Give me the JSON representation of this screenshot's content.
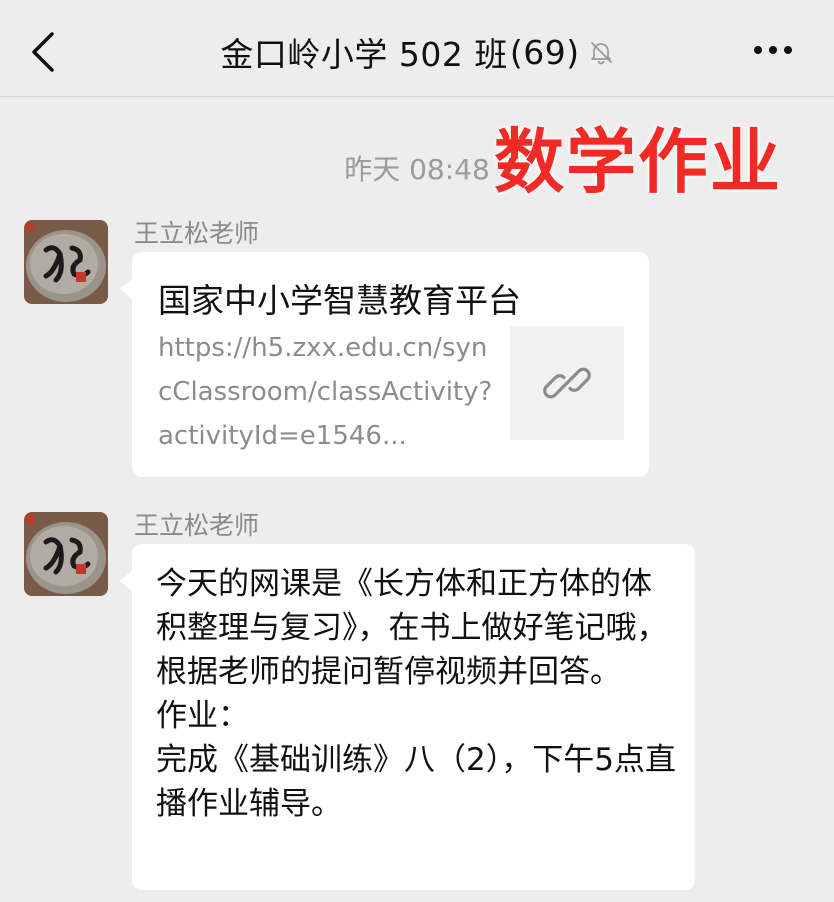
{
  "header": {
    "title": "金口岭小学 502 班",
    "member_count": "(69)",
    "back_icon": "chevron-left-icon",
    "mute_icon": "bell-slash-icon",
    "more_icon": "ellipsis-icon"
  },
  "overlay": {
    "label": "数学作业",
    "color": "#f22a25"
  },
  "timestamp": "昨天 08:48",
  "messages": [
    {
      "sender": "王立松老师",
      "type": "link",
      "title": "国家中小学智慧教育平台",
      "url": "https://h5.zxx.edu.cn/syncClassroom/classActivity?activityId=e1546...",
      "thumb_icon": "link-icon"
    },
    {
      "sender": "王立松老师",
      "type": "text",
      "text": "今天的网课是《长方体和正方体的体积整理与复习》，在书上做好笔记哦，根据老师的提问暂停视频并回答。\n作业：\n完成《基础训练》八（2），下午5点直播作业辅导。"
    }
  ],
  "colors": {
    "background": "#ededed",
    "bubble": "#ffffff",
    "secondary_text": "#8a8a8a"
  }
}
